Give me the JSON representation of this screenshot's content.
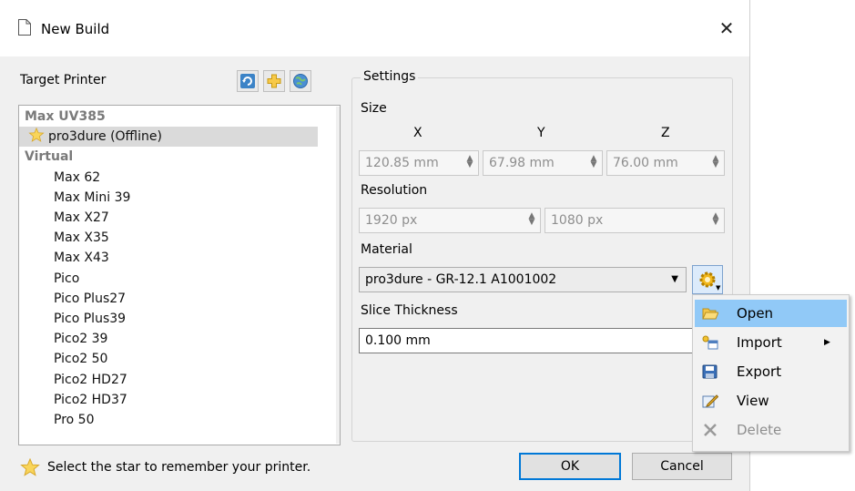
{
  "window": {
    "title": "New Build",
    "close_glyph": "✕"
  },
  "target_printer": {
    "label": "Target Printer",
    "toolbar_icons": [
      "refresh-icon",
      "add-printer-icon",
      "globe-icon"
    ],
    "groups": [
      {
        "label": "Max UV385",
        "items": [
          {
            "label": "pro3dure (Offline)",
            "selected": true,
            "starred": true
          }
        ]
      },
      {
        "label": "Virtual",
        "items": [
          {
            "label": "Max 62"
          },
          {
            "label": "Max Mini 39"
          },
          {
            "label": "Max X27"
          },
          {
            "label": "Max X35"
          },
          {
            "label": "Max X43"
          },
          {
            "label": "Pico"
          },
          {
            "label": "Pico Plus27"
          },
          {
            "label": "Pico Plus39"
          },
          {
            "label": "Pico2 39"
          },
          {
            "label": "Pico2 50"
          },
          {
            "label": "Pico2 HD27"
          },
          {
            "label": "Pico2 HD37"
          },
          {
            "label": "Pro 50"
          }
        ]
      }
    ]
  },
  "settings": {
    "group_label": "Settings",
    "size": {
      "label": "Size",
      "x": {
        "label": "X",
        "value": "120.85 mm"
      },
      "y": {
        "label": "Y",
        "value": "67.98 mm"
      },
      "z": {
        "label": "Z",
        "value": "76.00 mm"
      }
    },
    "resolution": {
      "label": "Resolution",
      "w": "1920 px",
      "h": "1080 px"
    },
    "material": {
      "label": "Material",
      "value": "pro3dure - GR-12.1 A1001002"
    },
    "slice_thickness": {
      "label": "Slice Thickness",
      "value": "0.100 mm"
    }
  },
  "footer": {
    "hint": "Select the star to remember your printer.",
    "ok": "OK",
    "cancel": "Cancel"
  },
  "context_menu": {
    "items": [
      {
        "label": "Open",
        "icon": "folder-open-icon",
        "highlighted": true
      },
      {
        "label": "Import",
        "icon": "import-icon",
        "submenu": true
      },
      {
        "label": "Export",
        "icon": "save-icon"
      },
      {
        "label": "View",
        "icon": "view-icon"
      },
      {
        "label": "Delete",
        "icon": "delete-icon",
        "disabled": true
      }
    ]
  },
  "colors": {
    "accent": "#0078d7",
    "menu_highlight": "#91c9f7",
    "dialog_bg": "#f0f0f0",
    "star": "#f5c518"
  }
}
